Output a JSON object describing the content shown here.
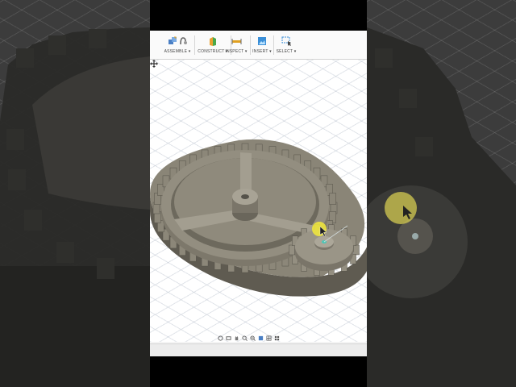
{
  "toolbar": {
    "groups": [
      {
        "label": "ASSEMBLE ▾",
        "icon": "assemble-icon"
      },
      {
        "label": "CONSTRUCT ▾",
        "icon": "construct-plane-icon"
      },
      {
        "label": "INSPECT ▾",
        "icon": "measure-icon"
      },
      {
        "label": "INSERT ▾",
        "icon": "insert-image-icon"
      },
      {
        "label": "SELECT ▾",
        "icon": "select-window-icon"
      }
    ]
  },
  "navbar": {
    "icons": [
      "orbit-icon",
      "look-at-icon",
      "pan-icon",
      "zoom-icon",
      "fit-icon",
      "display-settings-icon",
      "grid-icon",
      "viewports-icon"
    ]
  },
  "colors": {
    "toolbar_bg": "#fafafa",
    "viewport_bg": "#ffffff",
    "gear_body": "#8a8577",
    "gear_dark": "#5f5b51",
    "highlight": "#f3ea3a"
  }
}
